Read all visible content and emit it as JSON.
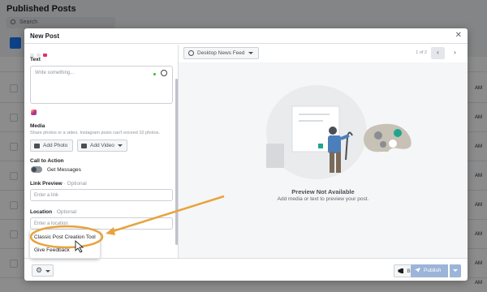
{
  "background": {
    "page_title": "Published Posts",
    "search_placeholder": "Search",
    "row_times": [
      "AM",
      "AM",
      "AM",
      "AM",
      "AM",
      "AM",
      "AM",
      "AM",
      "AM"
    ]
  },
  "modal": {
    "title": "New Post",
    "close_glyph": "✕"
  },
  "left": {
    "text_label": "Text",
    "text_placeholder": "Write something...",
    "media_label": "Media",
    "media_hint": "Share photos or a video. Instagram posts can't exceed 10 photos.",
    "add_photo": "Add Photo",
    "add_video": "Add Video",
    "cta_label": "Call to Action",
    "get_messages": "Get Messages",
    "link_preview_label": "Link Preview",
    "optional_suffix": " · Optional",
    "link_placeholder": "Enter a link",
    "location_label": "Location",
    "location_placeholder": "Enter a location"
  },
  "popup": {
    "items": [
      "Classic Post Creation Tool",
      "Give Feedback"
    ]
  },
  "preview": {
    "feed_label": "Desktop News Feed",
    "pager": "1 of 2",
    "prev_glyph": "‹",
    "next_glyph": "›",
    "title": "Preview Not Available",
    "subtitle": "Add media or text to preview your post."
  },
  "footer": {
    "gear_glyph": "⚙",
    "boost_label": "Boost",
    "publish_label": "Publish"
  },
  "colors": {
    "accent": "#1877f2",
    "publish_disabled": "#9cb4d8",
    "annotation": "#e8a33d"
  }
}
